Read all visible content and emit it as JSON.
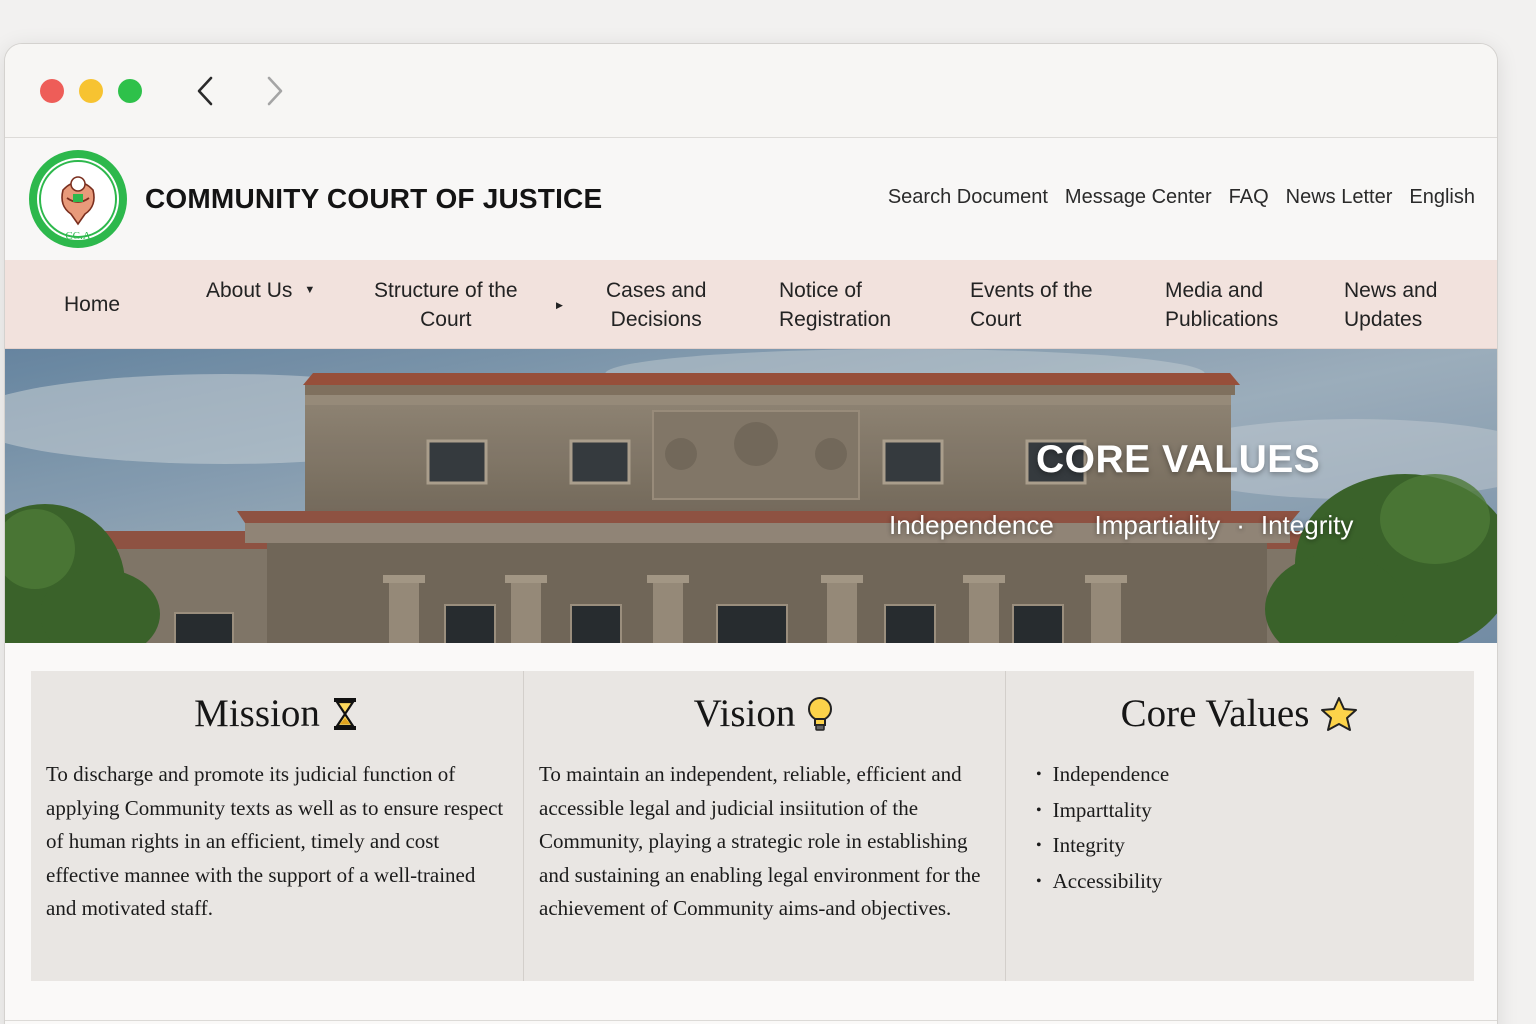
{
  "browser": {
    "back_icon": "chevron-left-icon",
    "forward_icon": "chevron-right-icon"
  },
  "header": {
    "logo_text": "CC.A",
    "site_title": "COMMUNITY COURT OF JUSTICE",
    "util_links": [
      "Search Document",
      "Message Center",
      "FAQ",
      "News Letter",
      "English"
    ]
  },
  "nav": {
    "items": [
      {
        "line1": "Home",
        "line2": ""
      },
      {
        "line1": "About Us",
        "line2": ""
      },
      {
        "line1": "Structure of the",
        "line2": "Court"
      },
      {
        "line1": "Cases and",
        "line2": "Decisions"
      },
      {
        "line1": "Notice of",
        "line2": "Registration"
      },
      {
        "line1": "Events of the",
        "line2": "Court"
      },
      {
        "line1": "Media and",
        "line2": "Publications"
      },
      {
        "line1": "News and",
        "line2": "Updates"
      }
    ]
  },
  "hero": {
    "title": "CORE VALUES",
    "values": [
      "Independence",
      "Impartiality",
      "Integrity"
    ],
    "separator": "·"
  },
  "cards": {
    "mission": {
      "title": "Mission",
      "icon": "hourglass-icon",
      "text": "To discharge and promote its judicial function of applying Community texts as well as to ensure respect of human rights in an efficient, timely and cost effective mannee with the support of a well-trained and motivated staff."
    },
    "vision": {
      "title": "Vision",
      "icon": "lightbulb-icon",
      "text": "To maintain an independent, reliable, efficient and accessible legal and judicial insiitution of the Community, playing a strategic role in establishing and sustaining an enabling legal environment for the achievement of Community aims-and objectives."
    },
    "core_values": {
      "title": "Core Values",
      "icon": "star-icon",
      "items": [
        "Independence",
        "Imparttality",
        "Integrity",
        "Accessibility"
      ]
    }
  },
  "colors": {
    "nav_bg": "#f2e2dd",
    "card_bg": "#e9e6e3",
    "logo_green": "#2db84c"
  }
}
